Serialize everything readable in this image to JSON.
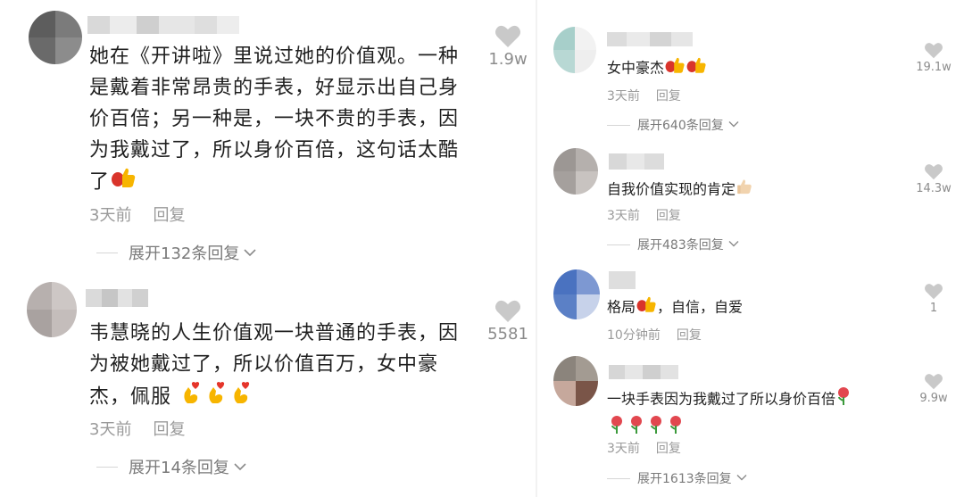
{
  "left_comments": [
    {
      "text_lines": [
        "她在《开讲啦》里说过她的价值观。一种",
        "是戴着非常昂贵的手表，好显示出自己身",
        "价百倍；另一种是，一块不贵的手表，因",
        "为我戴过了，所以身价百倍，这句话太酷",
        "了"
      ],
      "time": "3天前",
      "reply": "回复",
      "expand": "展开132条回复",
      "likes": "1.9w"
    },
    {
      "text_lines": [
        "韦慧晓的人生价值观一块普通的手表，因",
        "为被她戴过了，所以价值百万，女中豪",
        "杰，佩服"
      ],
      "time": "3天前",
      "reply": "回复",
      "expand": "展开14条回复",
      "likes": "5581"
    }
  ],
  "right_comments": [
    {
      "text": "女中豪杰",
      "time": "3天前",
      "reply": "回复",
      "expand": "展开640条回复",
      "likes": "19.1w"
    },
    {
      "text": "自我价值实现的肯定",
      "time": "3天前",
      "reply": "回复",
      "expand": "展开483条回复",
      "likes": "14.3w"
    },
    {
      "text_a": "格局",
      "text_b": "，自信，自爱",
      "time": "10分钟前",
      "reply": "回复",
      "likes": "1"
    },
    {
      "text": "一块手表因为我戴过了所以身价百倍",
      "time": "3天前",
      "reply": "回复",
      "expand": "展开1613条回复",
      "likes": "9.9w"
    }
  ],
  "icons": {
    "like": "heart-icon",
    "thumbs": "thumbs-up-emoji",
    "fingers": "finger-heart-emoji",
    "rose": "rose-emoji",
    "chevron": "chevron-down-icon"
  },
  "colors": {
    "text": "#1f1f1f",
    "meta": "#9a9a9a",
    "heart": "#c9c9c9",
    "background": "#ffffff"
  }
}
